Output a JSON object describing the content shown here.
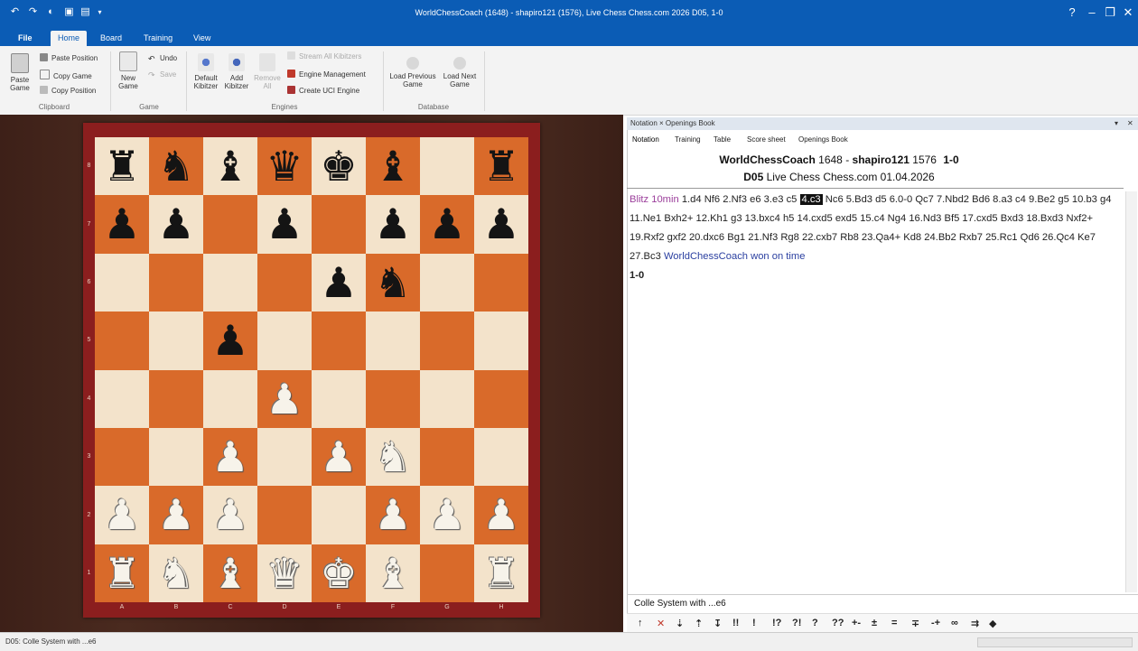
{
  "app": {
    "title": "WorldChessCoach (1648) - shapiro121 (1576), Live Chess Chess.com 2026  D05, 1-0",
    "window_controls": [
      "?",
      "–",
      "❐",
      "✕"
    ]
  },
  "tabs": [
    "File",
    "Home",
    "Board",
    "Training",
    "View"
  ],
  "active_tab": "Home",
  "ribbon": {
    "clipboard": {
      "paste_game": "Paste Game",
      "paste_position": "Paste Position",
      "copy_game": "Copy Game",
      "copy_position": "Copy Position",
      "group": "Clipboard"
    },
    "game": {
      "new_game": "New Game",
      "undo": "Undo",
      "save": "Save",
      "group": "Game"
    },
    "engines": {
      "default_kibitzer": "Default Kibitzer",
      "add_kibitzer": "Add Kibitzer",
      "remove_all": "Remove All",
      "stream_all": "Stream All Kibitzers",
      "engine_management": "Engine Management",
      "create_uci": "Create UCI Engine",
      "group": "Engines"
    },
    "database": {
      "load_previous": "Load Previous Game",
      "load_next": "Load Next Game",
      "group": "Database"
    }
  },
  "board": {
    "ranks": [
      "8",
      "7",
      "6",
      "5",
      "4",
      "3",
      "2",
      "1"
    ],
    "files": [
      "A",
      "B",
      "C",
      "D",
      "E",
      "F",
      "G",
      "H"
    ],
    "position": [
      "rnbqkb.r",
      "pp.p.ppp",
      "....pn..",
      "..p.....",
      "...P....",
      "..P.PN..",
      "PPP..PPP",
      "RNBQKB.R"
    ]
  },
  "panel": {
    "header": "Notation × Openings Book",
    "subtabs": [
      "Notation",
      "Training",
      "Table",
      "Score sheet",
      "Openings Book"
    ],
    "white": "WorldChessCoach",
    "white_elo": "1648",
    "black": "shapiro121",
    "black_elo": "1576",
    "result": "1-0",
    "eco": "D05",
    "event": "Live Chess Chess.com 01.04.2026",
    "movetext": {
      "blitz": "Blitz 10min",
      "moves": [
        "1.d4",
        "Nf6",
        "2.Nf3",
        "e6",
        "3.e3",
        "c5",
        "4.c3",
        "Nc6",
        "5.Bd3",
        "d5",
        "6.0-0",
        "Qc7",
        "7.Nbd2",
        "Bd6",
        "8.a3",
        "c4",
        "9.Be2",
        "g5",
        "10.b3",
        "g4",
        "11.Ne1",
        "Bxh2+",
        "12.Kh1",
        "g3",
        "13.bxc4",
        "h5",
        "14.cxd5",
        "exd5",
        "15.c4",
        "Ng4",
        "16.Nd3",
        "Bf5",
        "17.cxd5",
        "Bxd3",
        "18.Bxd3",
        "Nxf2+",
        "19.Rxf2",
        "gxf2",
        "20.dxc6",
        "Bg1",
        "21.Nf3",
        "Rg8",
        "22.cxb7",
        "Rb8",
        "23.Qa4+",
        "Kd8",
        "24.Bb2",
        "Rxb7",
        "25.Rc1",
        "Qd6",
        "26.Qc4",
        "Ke7",
        "27.Bc3"
      ],
      "current_move": "4.c3",
      "ending": "WorldChessCoach won on time",
      "final": "1-0"
    },
    "opening_name": "Colle System with ...e6",
    "tool_symbols": [
      "!!",
      "!",
      "!?",
      "?!",
      "?",
      "??",
      "+-",
      "±",
      "=",
      "∓",
      "-+",
      "∞"
    ]
  },
  "status": {
    "text": "D05: Colle System with ...e6"
  },
  "colors": {
    "titlebar": "#0b5cb5",
    "light_square": "#f3e3cb",
    "dark_square": "#d96a2a",
    "frame": "#8b1e1e"
  }
}
